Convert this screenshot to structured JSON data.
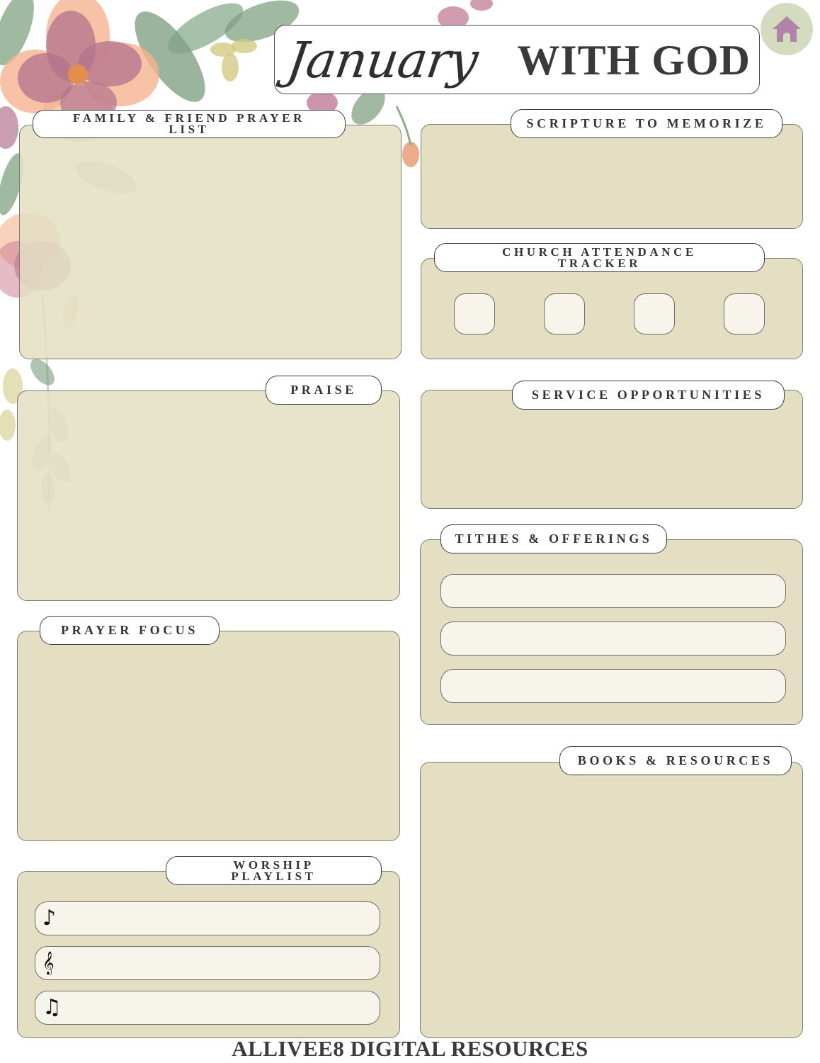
{
  "header": {
    "month": "January",
    "title_suffix": "WITH GOD",
    "home_button_label": "Home"
  },
  "colors": {
    "panel_bg": "#e4dfc3",
    "field_bg": "#f7f4ec",
    "home_circle": "#d4dcbf",
    "home_icon": "#b283a8",
    "text_dark": "#333333"
  },
  "sections": {
    "family_prayer": {
      "title_line1": "FAMILY & FRIEND PRAYER",
      "title_line2": "LIST"
    },
    "scripture": {
      "title": "SCRIPTURE TO MEMORIZE"
    },
    "church_attendance": {
      "title_line1": "CHURCH ATTENDANCE",
      "title_line2": "TRACKER",
      "checkbox_count": 4
    },
    "praise": {
      "title": "PRAISE"
    },
    "service": {
      "title": "SERVICE OPPORTUNITIES"
    },
    "tithes": {
      "title": "TITHES & OFFERINGS",
      "field_count": 3
    },
    "prayer_focus": {
      "title": "PRAYER FOCUS"
    },
    "books": {
      "title": "BOOKS & RESOURCES"
    },
    "worship": {
      "title_line1": "WORSHIP",
      "title_line2": "PLAYLIST",
      "entries": [
        {
          "icon": "♪",
          "icon_name": "eighth-note-icon",
          "value": ""
        },
        {
          "icon": "𝄞",
          "icon_name": "treble-clef-icon",
          "value": ""
        },
        {
          "icon": "♫",
          "icon_name": "beamed-notes-icon",
          "value": ""
        }
      ]
    }
  },
  "footer": {
    "brand": "ALLIVEE8 DIGITAL RESOURCES"
  }
}
